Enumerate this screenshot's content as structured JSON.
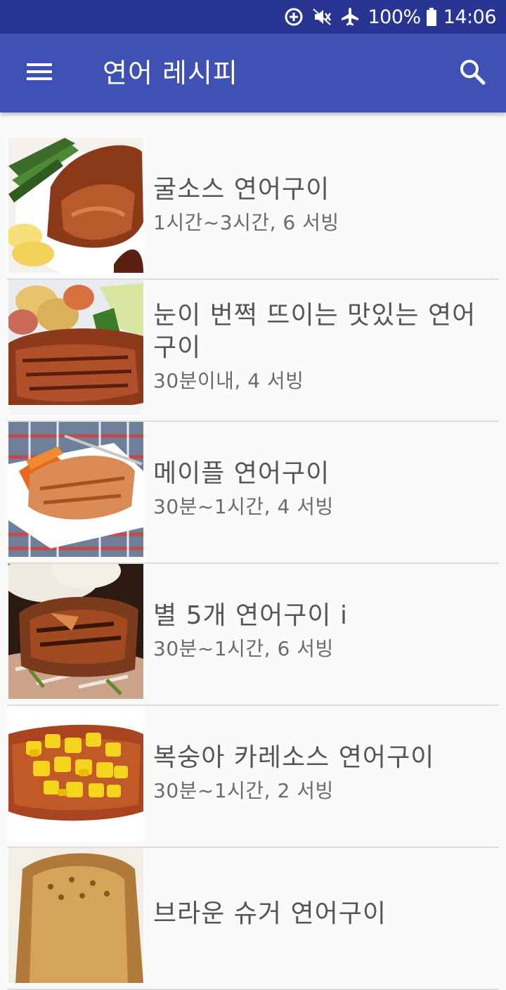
{
  "status_bar": {
    "battery_percent": "100%",
    "time": "14:06",
    "icons": [
      "data-saver-icon",
      "mute-vibrate-icon",
      "airplane-mode-icon",
      "battery-icon"
    ]
  },
  "app_bar": {
    "title": "연어 레시피",
    "menu_icon": "hamburger-menu-icon",
    "search_icon": "search-icon",
    "background": "#3f51b5",
    "status_background": "#283593"
  },
  "recipes": [
    {
      "title": "굴소스 연어구이",
      "meta": "1시간~3시간, 6 서빙",
      "image": "grilled-salmon-oyster-sauce"
    },
    {
      "title": "눈이 번쩍 뜨이는 맛있는 연어구이",
      "meta": "30분이내, 4 서빙",
      "image": "grilled-salmon-potatoes"
    },
    {
      "title": "메이플 연어구이",
      "meta": "30분~1시간, 4 서빙",
      "image": "maple-salmon-plate"
    },
    {
      "title": "별 5개 연어구이 i",
      "meta": "30분~1시간, 6 서빙",
      "image": "five-star-salmon"
    },
    {
      "title": "복숭아 카레소스 연어구이",
      "meta": "30분~1시간, 2 서빙",
      "image": "peach-curry-salmon"
    },
    {
      "title": "브라운 슈거 연어구이",
      "meta": "",
      "image": "brown-sugar-salmon"
    }
  ]
}
